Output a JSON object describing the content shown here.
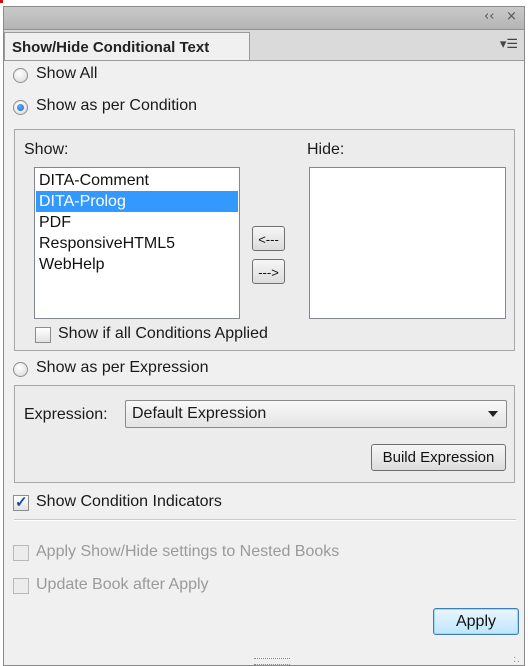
{
  "panel": {
    "tab_title": "Show/Hide Conditional Text",
    "window_controls": {
      "collapse": "‹‹",
      "close": "×"
    },
    "menu_icon": "panel-menu-icon"
  },
  "visibility_mode": {
    "show_all_label": "Show All",
    "show_as_per_condition_label": "Show as per Condition",
    "show_as_per_expression_label": "Show as per Expression",
    "selected": "show_as_per_condition"
  },
  "conditions": {
    "show_label": "Show:",
    "hide_label": "Hide:",
    "show_items": [
      "DITA-Comment",
      "DITA-Prolog",
      "PDF",
      "ResponsiveHTML5",
      "WebHelp"
    ],
    "selected_index": 1,
    "hide_items": [],
    "move_to_show_label": "<---",
    "move_to_hide_label": "--->",
    "show_if_all_label": "Show if all Conditions Applied",
    "show_if_all_checked": false
  },
  "expression": {
    "label": "Expression:",
    "selected": "Default Expression",
    "build_button": "Build Expression"
  },
  "options": {
    "show_indicators_label": "Show Condition Indicators",
    "show_indicators_checked": true,
    "apply_nested_label": "Apply Show/Hide settings to Nested Books",
    "update_book_label": "Update Book after Apply"
  },
  "actions": {
    "apply_label": "Apply"
  },
  "colors": {
    "selection": "#3399ff",
    "panel_bg": "#f0f0f0",
    "check": "#1c4e9a"
  }
}
